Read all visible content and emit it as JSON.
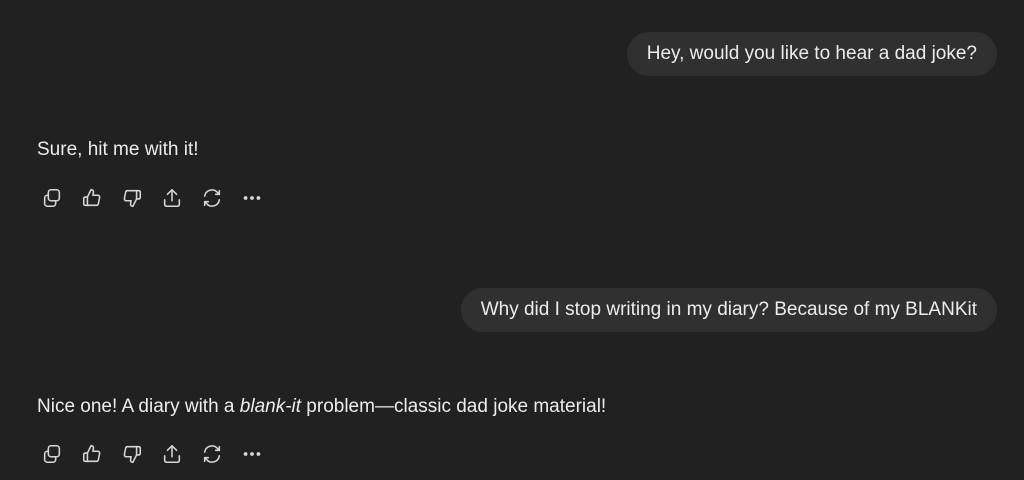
{
  "messages": [
    {
      "role": "user",
      "text": "Hey, would you like to hear a dad joke?"
    },
    {
      "role": "assistant",
      "text": "Sure, hit me with it!"
    },
    {
      "role": "user",
      "text": "Why did I stop writing in my diary? Because of my BLANKit"
    },
    {
      "role": "assistant",
      "text_before": "Nice one! A diary with a ",
      "text_italic": "blank-it",
      "text_after": " problem—classic dad joke material!"
    }
  ],
  "action_icons": [
    "copy-icon",
    "thumbs-up-icon",
    "thumbs-down-icon",
    "share-icon",
    "regenerate-icon",
    "more-icon"
  ]
}
